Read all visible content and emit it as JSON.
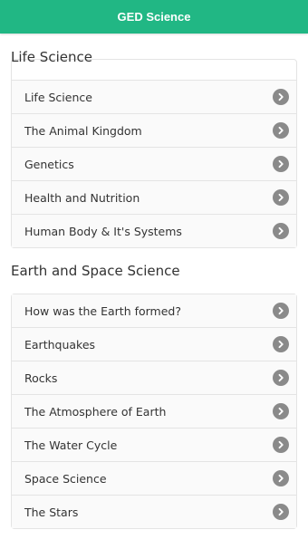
{
  "app_bar": {
    "title": "GED Science"
  },
  "sections": [
    {
      "title": "Life Science",
      "items": [
        "Life Science",
        "The Animal Kingdom",
        "Genetics",
        "Health and Nutrition",
        "Human Body & It's Systems"
      ]
    },
    {
      "title": "Earth and Space Science",
      "items": [
        "How was the Earth formed?",
        "Earthquakes",
        "Rocks",
        "The Atmosphere of Earth",
        "The Water Cycle",
        "Space Science",
        "The Stars"
      ]
    }
  ],
  "colors": {
    "accent": "#21b784",
    "chevron": "#8a8a8a"
  },
  "icons": {
    "item_arrow": "chevron-right-icon"
  }
}
